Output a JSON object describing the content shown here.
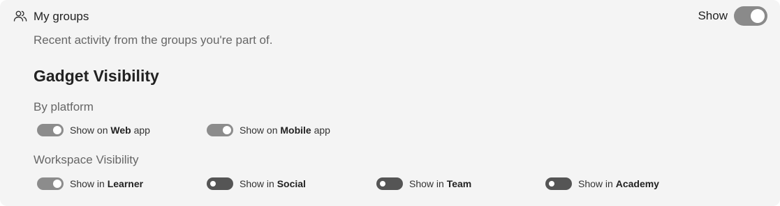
{
  "header": {
    "icon": "users-icon",
    "title": "My groups",
    "subtitle": "Recent activity from the groups you're part of.",
    "show_label": "Show",
    "show_enabled": true
  },
  "visibility": {
    "title": "Gadget Visibility",
    "platform": {
      "label": "By platform",
      "items": [
        {
          "prefix": "Show on ",
          "name": "Web",
          "suffix": " app",
          "enabled": true
        },
        {
          "prefix": "Show on ",
          "name": "Mobile",
          "suffix": " app",
          "enabled": true
        }
      ]
    },
    "workspace": {
      "label": "Workspace Visibility",
      "items": [
        {
          "prefix": "Show in ",
          "name": "Learner",
          "suffix": "",
          "enabled": true
        },
        {
          "prefix": "Show in ",
          "name": "Social",
          "suffix": "",
          "enabled": false
        },
        {
          "prefix": "Show in ",
          "name": "Team",
          "suffix": "",
          "enabled": false
        },
        {
          "prefix": "Show in ",
          "name": "Academy",
          "suffix": "",
          "enabled": false
        }
      ]
    }
  },
  "colors": {
    "toggle_on": "#8c8c8c",
    "toggle_off": "#555555",
    "card_bg": "#f4f4f4"
  }
}
